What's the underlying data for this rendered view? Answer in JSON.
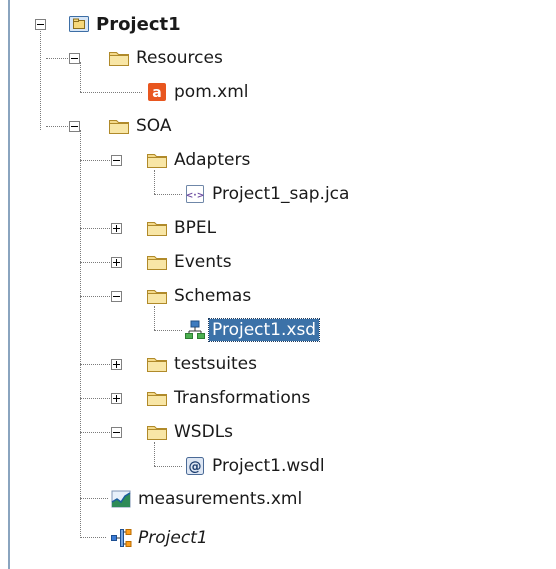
{
  "tree": {
    "root": {
      "label": "Project1",
      "icon": "project-icon",
      "expanded": true
    },
    "items": [
      {
        "label": "Resources",
        "icon": "folder-icon",
        "expanded": true,
        "depth": 1
      },
      {
        "label": "pom.xml",
        "icon": "maven-file-icon",
        "depth": 2
      },
      {
        "label": "SOA",
        "icon": "folder-icon",
        "expanded": true,
        "depth": 1
      },
      {
        "label": "Adapters",
        "icon": "folder-icon",
        "expanded": true,
        "depth": 2
      },
      {
        "label": "Project1_sap.jca",
        "icon": "jca-file-icon",
        "depth": 3
      },
      {
        "label": "BPEL",
        "icon": "folder-icon",
        "expanded": false,
        "depth": 2
      },
      {
        "label": "Events",
        "icon": "folder-icon",
        "expanded": false,
        "depth": 2
      },
      {
        "label": "Schemas",
        "icon": "folder-icon",
        "expanded": true,
        "depth": 2
      },
      {
        "label": "Project1.xsd",
        "icon": "xsd-schema-icon",
        "depth": 3,
        "selected": true
      },
      {
        "label": "testsuites",
        "icon": "folder-icon",
        "expanded": false,
        "depth": 2
      },
      {
        "label": "Transformations",
        "icon": "folder-icon",
        "expanded": false,
        "depth": 2
      },
      {
        "label": "WSDLs",
        "icon": "folder-icon",
        "expanded": true,
        "depth": 2
      },
      {
        "label": "Project1.wsdl",
        "icon": "wsdl-file-icon",
        "depth": 3
      },
      {
        "label": "measurements.xml",
        "icon": "measurements-chart-icon",
        "depth": 2
      },
      {
        "label": "Project1",
        "icon": "composite-icon",
        "depth": 2
      }
    ]
  },
  "colors": {
    "selection": "#3c72a8",
    "folder": "#f3d98a",
    "tree_line": "#7b7b7b"
  }
}
